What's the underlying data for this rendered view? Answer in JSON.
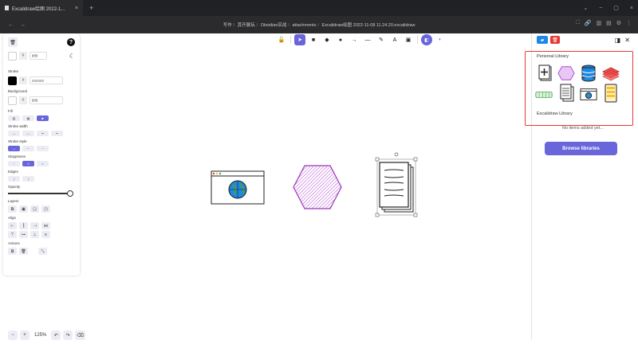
{
  "tab": {
    "title": "Excalidraw绘图 2022-1...",
    "close": "×",
    "new_tab": "+"
  },
  "window_controls": [
    "⌄",
    "−",
    "▢",
    "×"
  ],
  "nav": {
    "back": "←",
    "forward": "→",
    "breadcrumb": [
      "写作",
      "其开展坛",
      "Obsidian实战",
      "attachments",
      "Excalidraw绘图 2022-11-08 11.24.20.excalidraw"
    ],
    "separator": "/",
    "icons": [
      "⛶",
      "🔗",
      "▥",
      "▤",
      "⚙",
      "⋮"
    ]
  },
  "left_panel": {
    "trash_icon": "🗑",
    "help_icon": "?",
    "canvas_bg_hex": "ffffff",
    "stroke_label": "Stroke",
    "stroke_hex": "000000",
    "background_label": "Background",
    "background_hex": "ffffff",
    "fill_label": "Fill",
    "stroke_width_label": "Stroke width",
    "stroke_style_label": "Stroke style",
    "sloppiness_label": "Sloppiness",
    "edges_label": "Edges",
    "opacity_label": "Opacity",
    "opacity_value": 1.0,
    "layers_label": "Layers",
    "align_label": "Align",
    "actions_label": "Actions",
    "hash": "#",
    "colors": {
      "accent": "#6965db",
      "stroke": "#000000",
      "background": "#ffffff"
    }
  },
  "toolbar": {
    "tools": [
      "🔓",
      "➤",
      "■",
      "◆",
      "●",
      "→",
      "—",
      "✎",
      "A",
      "▣"
    ],
    "active_index": 1,
    "library_icon": "◧"
  },
  "right_panel": {
    "personal_library_label": "Personal Library",
    "excalidraw_library_label": "Excalidraw Library",
    "no_items": "No items added yet...",
    "browse_button": "Browse libraries",
    "highlight_color": "#e53935"
  },
  "zoom": {
    "minus": "−",
    "plus": "+",
    "value": "125%",
    "undo": "↶",
    "redo": "↷",
    "eraser": "⌫"
  }
}
